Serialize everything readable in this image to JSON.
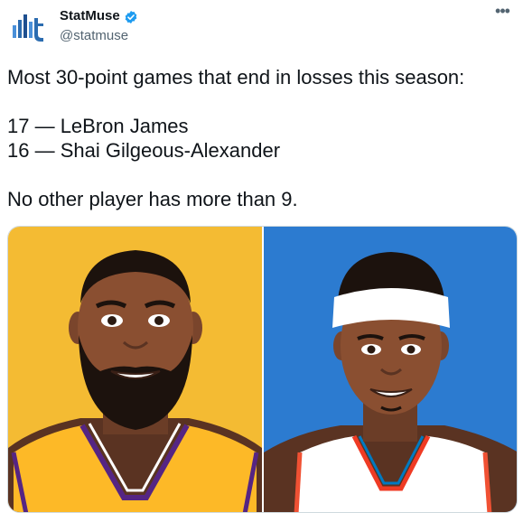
{
  "tweet": {
    "author_name": "StatMuse",
    "handle": "@statmuse",
    "more_icon": "more-horizontal-icon",
    "verified_icon": "verified-badge-icon",
    "logo_icon": "statmuse-logo-icon",
    "text": {
      "line1": "Most 30-point games that end in losses this season:",
      "line2": "17 — LeBron James",
      "line3": "16 — Shai Gilgeous-Alexander",
      "line4": "No other player has more than 9."
    }
  },
  "media": {
    "left_player": {
      "background": "#f4bb33",
      "jersey": "#fdb927"
    },
    "right_player": {
      "background": "#2c7bd0",
      "jersey": "#ffffff"
    }
  },
  "colors": {
    "verified": "#1d9bf0",
    "logo": "#2b6cb0",
    "secondary_text": "#536471"
  }
}
